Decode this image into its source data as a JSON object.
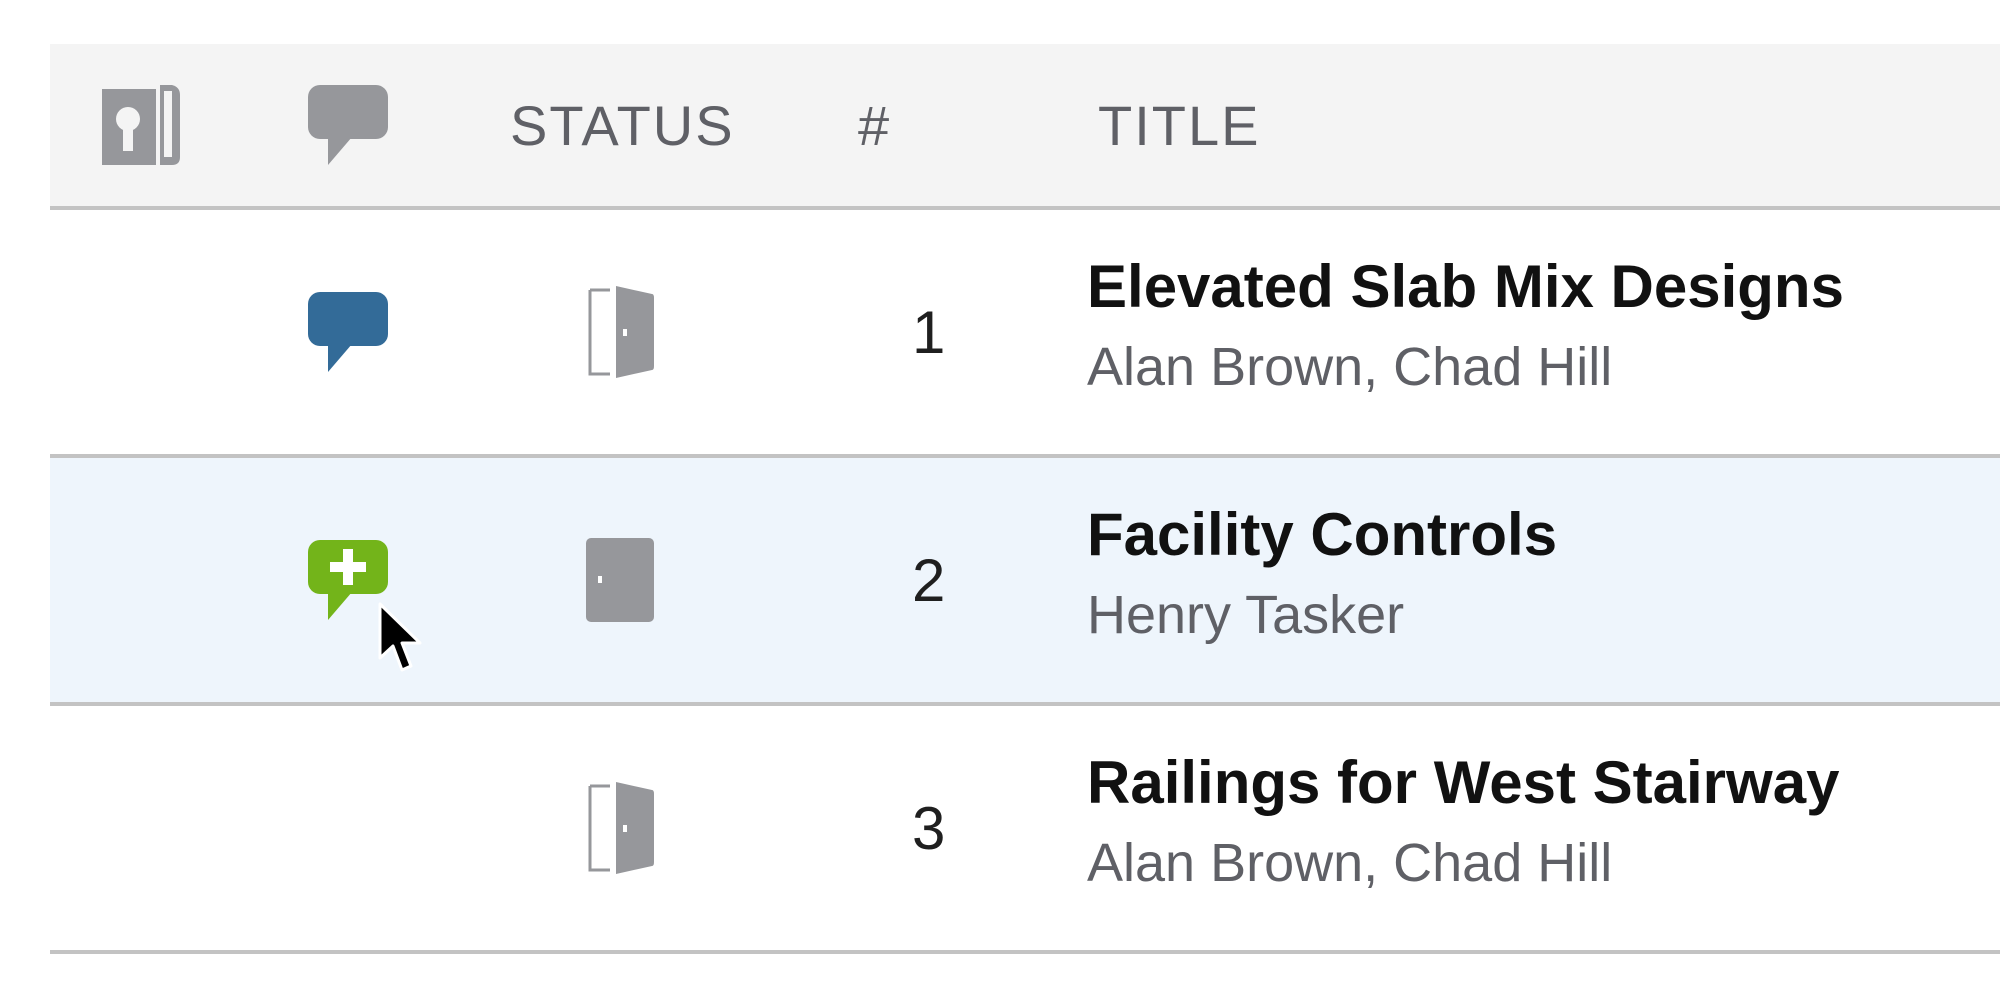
{
  "columns": {
    "icon_col1": "document-key-icon",
    "icon_col2": "comment-icon",
    "status_label": "STATUS",
    "number_label": "#",
    "title_label": "TITLE"
  },
  "rows": [
    {
      "comment_icon": "comment-icon",
      "comment_color": "#336b98",
      "status_icon": "door-open-icon",
      "number": "1",
      "title": "Elevated Slab Mix Designs",
      "assignees": "Alan Brown, Chad Hill"
    },
    {
      "comment_icon": "add-comment-icon",
      "comment_color": "#73b41a",
      "status_icon": "door-closed-icon",
      "number": "2",
      "title": "Facility Controls",
      "assignees": "Henry Tasker",
      "hovered": true
    },
    {
      "comment_icon": "",
      "status_icon": "door-open-icon",
      "number": "3",
      "title": "Railings for West Stairway",
      "assignees": "Alan Brown, Chad Hill"
    }
  ],
  "colors": {
    "header_bg": "#f4f4f4",
    "hover_row_bg": "#eef5fc",
    "icon_gray": "#96979b"
  }
}
